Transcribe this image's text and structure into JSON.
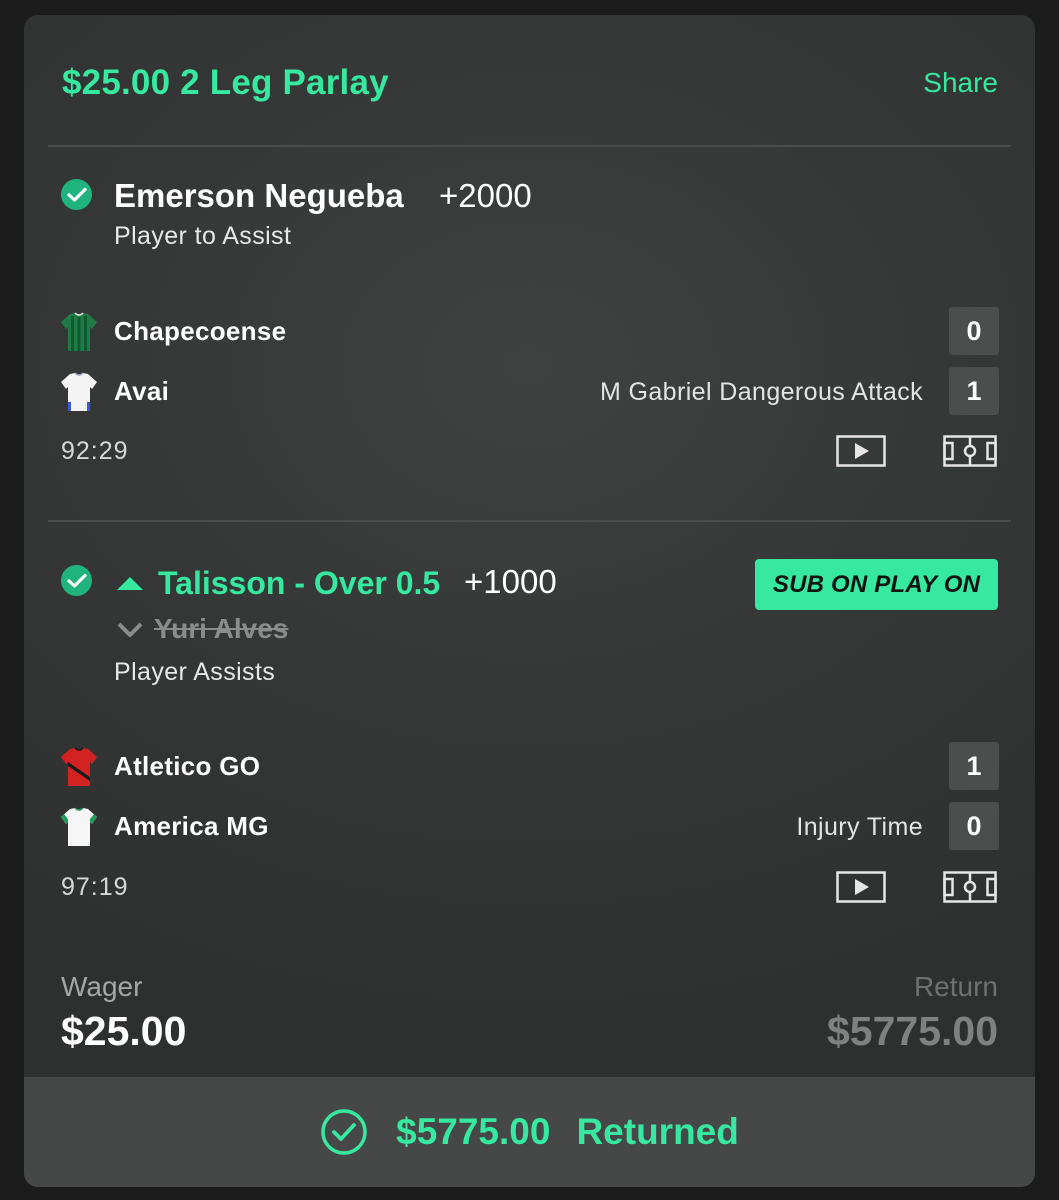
{
  "header": {
    "title": "$25.00 2 Leg Parlay",
    "share_label": "Share"
  },
  "legs": [
    {
      "selection": "Emerson Negueba",
      "odds": "+2000",
      "market": "Player to Assist",
      "teams": [
        {
          "name": "Chapecoense",
          "score": "0",
          "status": "",
          "jersey": "green-striped-jersey-icon"
        },
        {
          "name": "Avai",
          "score": "1",
          "status": "M Gabriel Dangerous Attack",
          "jersey": "white-jersey-icon"
        }
      ],
      "clock": "92:29"
    },
    {
      "sub_on": "Talisson - Over 0.5",
      "odds": "+1000",
      "sub_off": "Yuri Alves",
      "market": "Player Assists",
      "badge": "SUB ON PLAY ON",
      "teams": [
        {
          "name": "Atletico GO",
          "score": "1",
          "status": "",
          "jersey": "red-black-jersey-icon"
        },
        {
          "name": "America MG",
          "score": "0",
          "status": "Injury Time",
          "jersey": "white-green-jersey-icon"
        }
      ],
      "clock": "97:19"
    }
  ],
  "summary": {
    "wager_label": "Wager",
    "wager_value": "$25.00",
    "return_label": "Return",
    "return_value": "$5775.00"
  },
  "footer": {
    "amount": "$5775.00",
    "status": "Returned"
  },
  "colors": {
    "accent": "#36e8a0",
    "check": "#1fb37d",
    "card": "#353837",
    "footer": "#454847"
  }
}
